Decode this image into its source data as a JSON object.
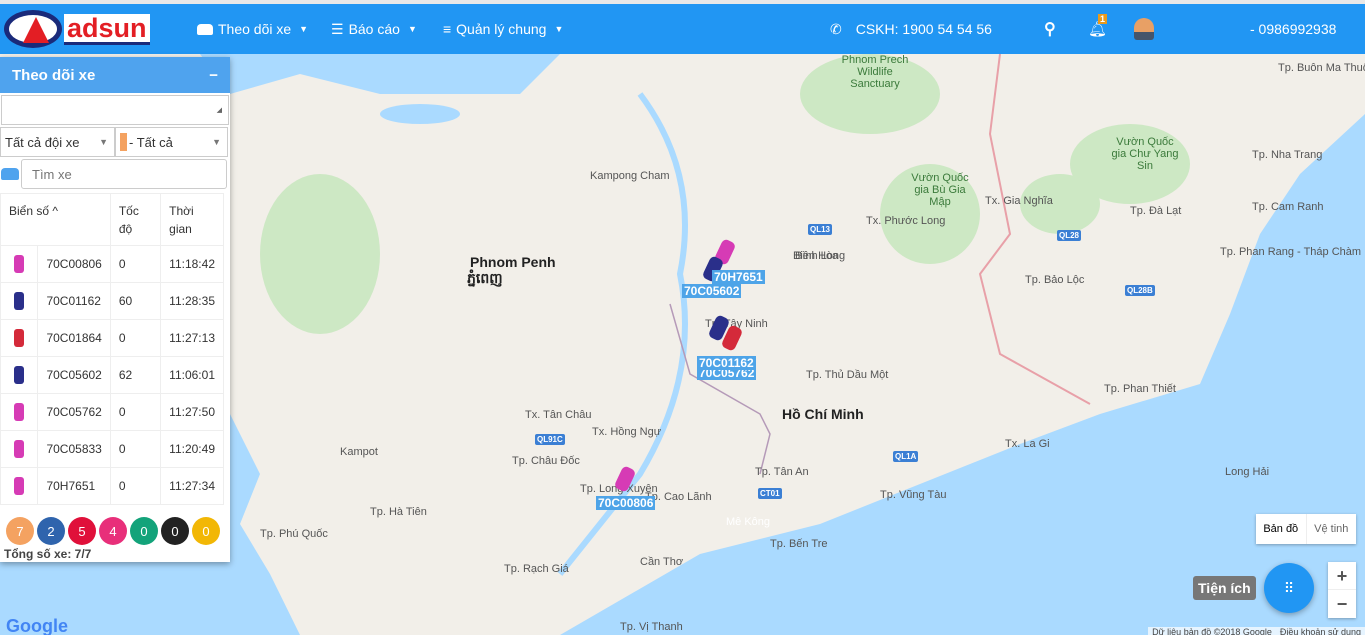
{
  "header": {
    "logo": "adsun",
    "menu": [
      {
        "label": "Theo dõi xe"
      },
      {
        "label": "Báo cáo"
      },
      {
        "label": "Quản lý chung"
      }
    ],
    "hotline": "CSKH: 1900 54 54 56",
    "notif_count": "1",
    "user": "- 0986992938"
  },
  "panel": {
    "title": "Theo dõi xe",
    "collapse": "−",
    "fleet_select": "Tất cả đội xe",
    "status_select": "- Tất cả",
    "search_placeholder": "Tìm xe",
    "columns": [
      "Biển số ^",
      "Tốc độ",
      "Thời gian"
    ],
    "rows": [
      {
        "plate": "70C00806",
        "speed": "0",
        "time": "11:18:42",
        "color": "#d63bb5"
      },
      {
        "plate": "70C01162",
        "speed": "60",
        "time": "11:28:35",
        "color": "#2a2f8a"
      },
      {
        "plate": "70C01864",
        "speed": "0",
        "time": "11:27:13",
        "color": "#d42a3a"
      },
      {
        "plate": "70C05602",
        "speed": "62",
        "time": "11:06:01",
        "color": "#2a2f8a"
      },
      {
        "plate": "70C05762",
        "speed": "0",
        "time": "11:27:50",
        "color": "#d63bb5"
      },
      {
        "plate": "70C05833",
        "speed": "0",
        "time": "11:20:49",
        "color": "#d63bb5"
      },
      {
        "plate": "70H7651",
        "speed": "0",
        "time": "11:27:34",
        "color": "#d63bb5"
      }
    ],
    "status_counts": [
      {
        "n": "7",
        "color": "#f4a261"
      },
      {
        "n": "2",
        "color": "#2f64ad"
      },
      {
        "n": "5",
        "color": "#e0103a"
      },
      {
        "n": "4",
        "color": "#e82f7a"
      },
      {
        "n": "0",
        "color": "#13a37a"
      },
      {
        "n": "0",
        "color": "#222222"
      },
      {
        "n": "0",
        "color": "#f2b705"
      }
    ],
    "total": "Tổng số xe: 7/7"
  },
  "map": {
    "type_map": "Bản đồ",
    "type_sat": "Vệ tinh",
    "utility": "Tiện ích",
    "zoom_in": "+",
    "zoom_out": "−",
    "google": "Google",
    "attribution": "Dữ liệu bản đồ ©2018 Google",
    "terms": "Điều khoản sử dụng",
    "places": [
      "Phnom Penh",
      "ភ្នំពេញ",
      "Hồ Chí Minh",
      "Tp. Tây Ninh",
      "Tp. Thủ Dầu Một",
      "Tp. Châu Đốc",
      "Tp. Cao Lãnh",
      "Tp. Long Xuyên",
      "Cần Thơ",
      "Tp. Rạch Giá",
      "Tp. Vũng Tàu",
      "Tp. Phan Thiết",
      "Tp. Đà Lạt",
      "Tp. Bảo Lộc",
      "Tp. Nha Trang",
      "Tp. Buôn Ma Thuột",
      "Tp. Bến Tre",
      "Tp. Tân An",
      "Tp. Hà Tiên",
      "Tp. Phú Quốc",
      "Tp. Cam Ranh",
      "Tp. Phan Rang - Tháp Chàm",
      "Kampong Cham",
      "Kampot",
      "Tx. Hồng Ngự",
      "Tp. Vị Thanh",
      "Tx. Tân Châu",
      "Biên Hòa",
      "Tx. La Gi",
      "Long Hải",
      "Tx. Gia Nghĩa",
      "Tx. Phước Long",
      "Bình Long",
      "Vườn Quốc gia Bù Gia Mập",
      "Vườn Quốc gia Chư Yang Sin",
      "Phnom Prech Wildlife Sanctuary",
      "Mê Kông"
    ],
    "vehicle_labels": [
      "70H7651",
      "70C05602",
      "70C01162",
      "70C05762",
      "70C00806"
    ]
  }
}
